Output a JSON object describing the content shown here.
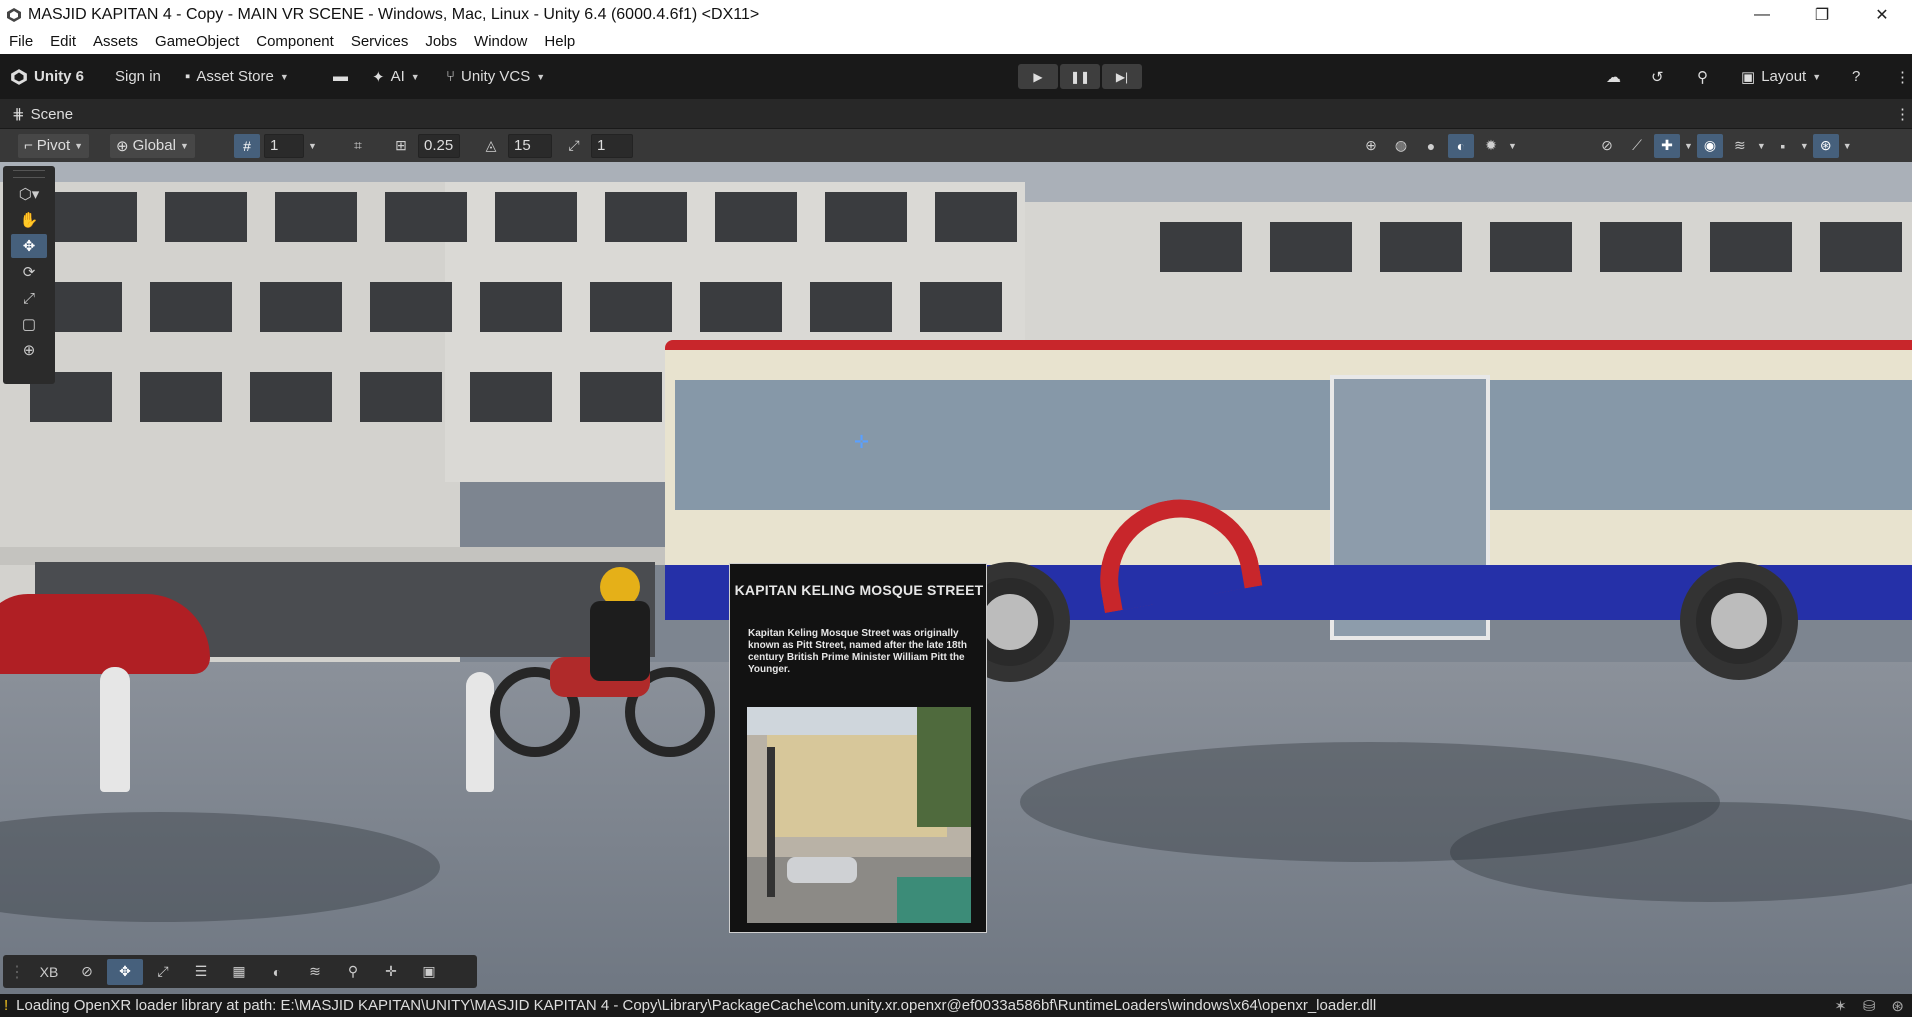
{
  "window": {
    "title": "MASJID KAPITAN 4 - Copy - MAIN VR SCENE - Windows, Mac, Linux - Unity 6.4 (6000.4.6f1) <DX11>",
    "controls": {
      "minimize": "—",
      "maximize": "❐",
      "close": "✕"
    }
  },
  "menu": [
    "File",
    "Edit",
    "Assets",
    "GameObject",
    "Component",
    "Services",
    "Jobs",
    "Window",
    "Help"
  ],
  "toolbar": {
    "unity_label": "Unity 6",
    "sign_in": "Sign in",
    "asset_store": "Asset Store",
    "ai": "AI",
    "vcs": "Unity VCS",
    "layout": "Layout"
  },
  "tab": {
    "scene": "Scene"
  },
  "scene_toolbar": {
    "pivot": "Pivot",
    "global": "Global",
    "grid_size": "1",
    "snap_increment": "0.25",
    "rotate_snap": "15",
    "scale_snap": "1"
  },
  "overlay": {
    "xb_label": "XB"
  },
  "info_panel": {
    "title": "KAPITAN KELING MOSQUE STREET",
    "body": "Kapitan Keling Mosque Street was originally known as Pitt Street, named after the late 18th century British Prime Minister William Pitt the Younger."
  },
  "status": {
    "message": "Loading OpenXR loader library at path: E:\\MASJID KAPITAN\\UNITY\\MASJID KAPITAN 4 - Copy\\Library\\PackageCache\\com.unity.xr.openxr@ef0033a586bf\\RuntimeLoaders\\windows\\x64\\openxr_loader.dll"
  },
  "colors": {
    "accent": "#46607c",
    "bus_red": "#c8262b",
    "bus_blue": "#2530a8"
  }
}
